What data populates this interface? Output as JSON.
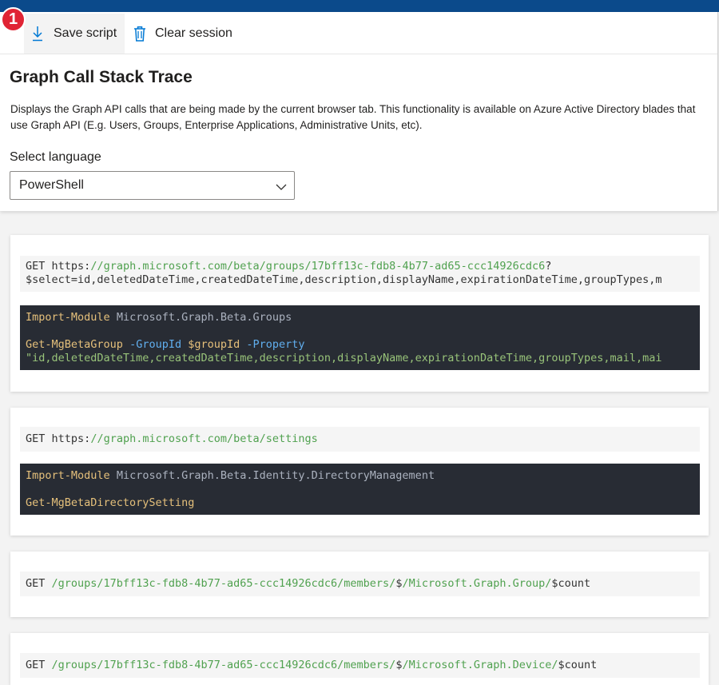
{
  "badge": "1",
  "toolbar": {
    "save_label": "Save script",
    "clear_label": "Clear session"
  },
  "panel": {
    "title": "Graph Call Stack Trace",
    "description": "Displays the Graph API calls that are being made by the current browser tab. This functionality is available on Azure Active Directory blades that use Graph API (E.g. Users, Groups, Enterprise Applications, Administrative Units, etc).",
    "language_label": "Select language",
    "language_value": "PowerShell"
  },
  "calls": [
    {
      "method": "GET",
      "url_prefix": "https:",
      "url_path": "//graph.microsoft.com/beta/groups/17bff13c-fdb8-4b77-ad65-ccc14926cdc6",
      "url_suffix": "?",
      "url_line2": "$select=id,deletedDateTime,createdDateTime,description,displayName,expirationDateTime,groupTypes,m",
      "code_import_cmd": "Import-Module",
      "code_import_module": "Microsoft.Graph.Beta.Groups",
      "code_cmd": "Get-MgBetaGroup",
      "code_param1": "-GroupId",
      "code_var1": "$groupId",
      "code_param2": "-Property",
      "code_string": "\"id,deletedDateTime,createdDateTime,description,displayName,expirationDateTime,groupTypes,mail,mai"
    },
    {
      "method": "GET",
      "url_prefix": "https:",
      "url_path": "//graph.microsoft.com/beta/settings",
      "code_import_cmd": "Import-Module",
      "code_import_module": "Microsoft.Graph.Beta.Identity.DirectoryManagement",
      "code_cmd": "Get-MgBetaDirectorySetting"
    },
    {
      "method": "GET",
      "url_path": "/groups/17bff13c-fdb8-4b77-ad65-ccc14926cdc6/members/",
      "url_mid": "$",
      "url_path2": "/Microsoft.Graph.Group/",
      "url_suffix": "$count"
    },
    {
      "method": "GET",
      "url_path": "/groups/17bff13c-fdb8-4b77-ad65-ccc14926cdc6/members/",
      "url_mid": "$",
      "url_path2": "/Microsoft.Graph.Device/",
      "url_suffix": "$count"
    }
  ],
  "colors": {
    "top_bar": "#0b4a8b",
    "badge": "#e02434",
    "accent_icon": "#0078d4",
    "code_background": "#282c34",
    "url_green": "#50a14f"
  },
  "icons": {
    "save": "download-icon",
    "clear": "trash-icon",
    "select": "chevron-down-icon"
  }
}
